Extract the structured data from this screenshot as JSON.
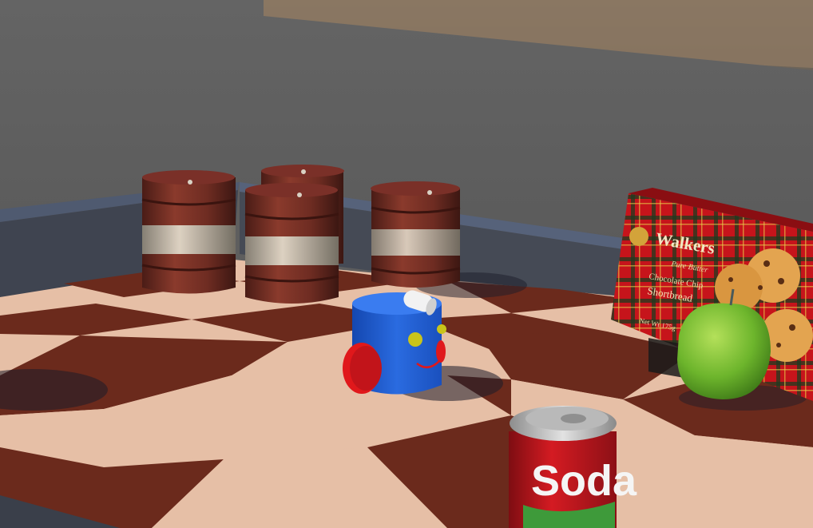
{
  "scene": {
    "colors": {
      "sky_top": "#7d7468",
      "wall": "#5f5f5f",
      "board_light": "#e8c0a8",
      "board_dark": "#6b2a1c",
      "robot_body": "#1f5fd1",
      "robot_wheel": "#e0181b",
      "robot_eye": "#c9c41a",
      "barrel_rust": "#6e2c22",
      "apple": "#6db52c",
      "soda_red": "#c8171e",
      "box_red": "#c6141b"
    },
    "cookie_box": {
      "brand": "Walkers",
      "line1": "Pure Butter",
      "line2": "Chocolate Chip",
      "line3": "Shortbread",
      "weight": "Net Wt 175g"
    },
    "soda_can": {
      "label": "Soda"
    }
  }
}
